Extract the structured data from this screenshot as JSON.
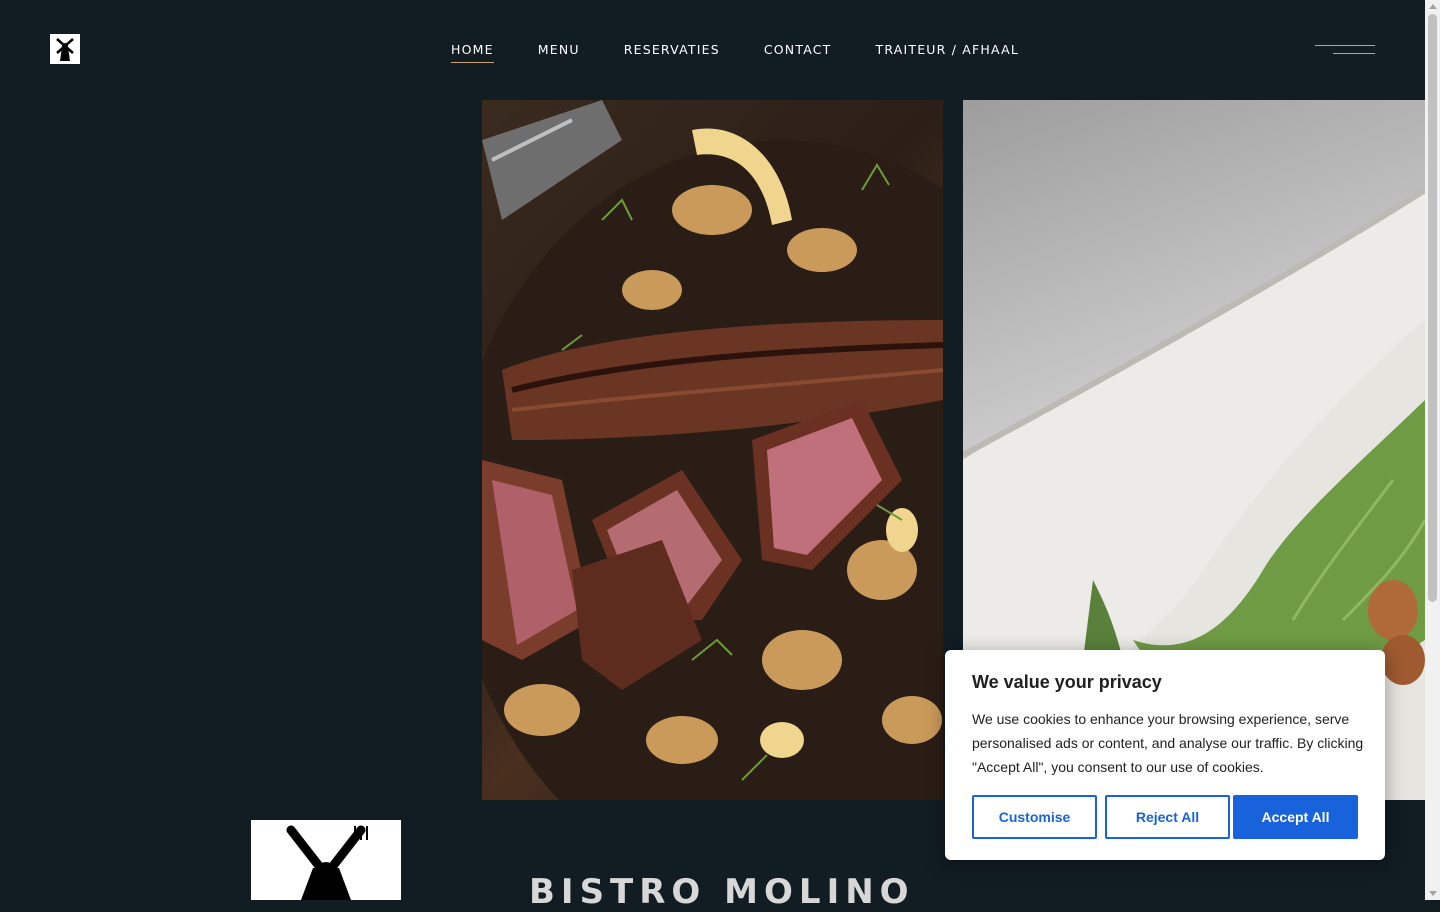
{
  "nav": {
    "items": [
      {
        "label": "HOME",
        "active": true
      },
      {
        "label": "MENU",
        "active": false
      },
      {
        "label": "RESERVATIES",
        "active": false
      },
      {
        "label": "CONTACT",
        "active": false
      },
      {
        "label": "TRAITEUR / AFHAAL",
        "active": false
      }
    ]
  },
  "hero": {
    "title": "BISTRO MOLINO"
  },
  "cookie_banner": {
    "title": "We value your privacy",
    "text": "We use cookies to enhance your browsing experience, serve personalised ads or content, and analyse our traffic. By clicking \"Accept All\", you consent to our use of cookies.",
    "customise_label": "Customise",
    "reject_label": "Reject All",
    "accept_label": "Accept All"
  },
  "colors": {
    "background": "#111c23",
    "accent": "#c8a36b",
    "button_blue": "#1863dc"
  },
  "icons": {
    "logo": "windmill-icon",
    "badge": "knife-fork-windmill-icon",
    "menu": "hamburger-icon"
  }
}
